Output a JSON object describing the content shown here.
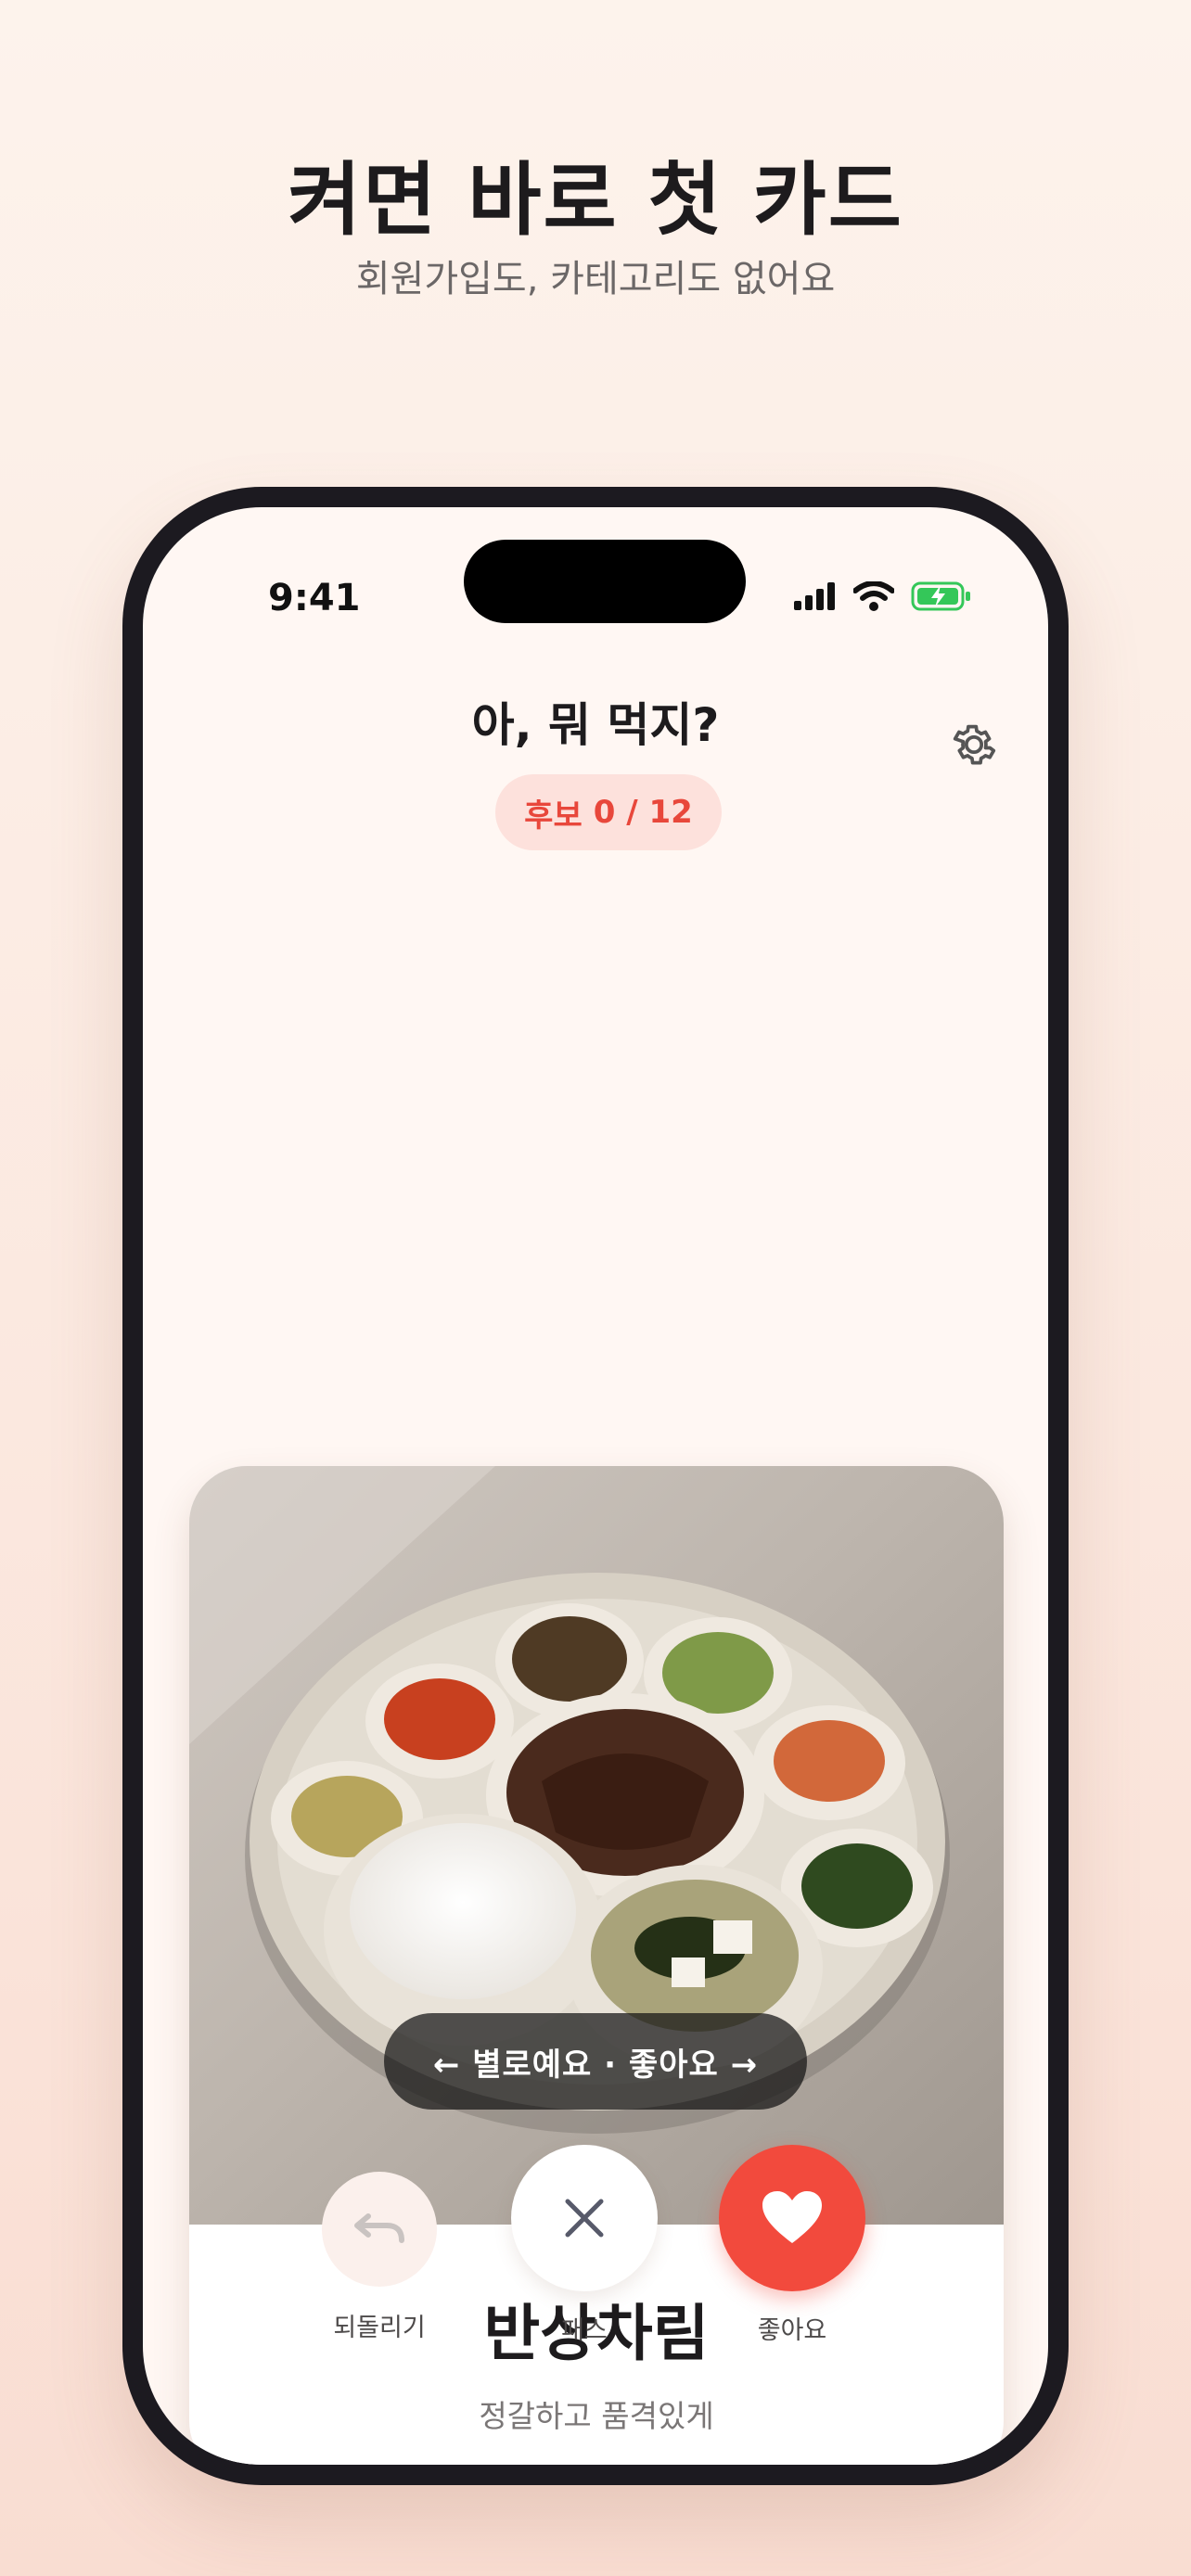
{
  "promo": {
    "title": "켜면 바로 첫 카드",
    "subtitle": "회원가입도, 카테고리도 없어요"
  },
  "status_bar": {
    "time": "9:41",
    "icons": [
      "signal-icon",
      "wifi-icon",
      "battery-charging-icon"
    ]
  },
  "header": {
    "title": "아, 뭐 먹지?",
    "badge_label": "후보",
    "badge_count": "0 / 12",
    "settings_icon": "gear-icon"
  },
  "card": {
    "name": "반상차림",
    "description": "정갈하고 품격있게",
    "swipe_hint": "← 별로예요 · 좋아요 →",
    "hand_emoji": "👆"
  },
  "actions": {
    "undo_label": "되돌리기",
    "pass_label": "패스",
    "like_label": "좋아요"
  },
  "colors": {
    "accent": "#f24a3d",
    "badge_bg": "#fde1dc",
    "background": "#fff7f3"
  }
}
